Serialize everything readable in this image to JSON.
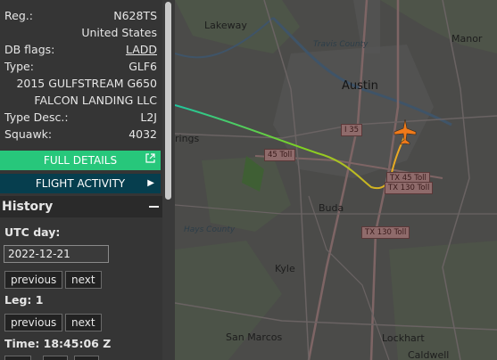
{
  "info": {
    "reg_label": "Reg.:",
    "reg_value": "N628TS",
    "country": "United States",
    "dbflags_label": "DB flags:",
    "dbflags_value": "LADD",
    "type_label": "Type:",
    "type_value": "GLF6",
    "model": "2015 GULFSTREAM G650",
    "owner": "FALCON LANDING LLC",
    "typedesc_label": "Type Desc.:",
    "typedesc_value": "L2J",
    "squawk_label": "Squawk:",
    "squawk_value": "4032"
  },
  "buttons": {
    "full_details": "FULL DETAILS",
    "flight_activity": "FLIGHT ACTIVITY"
  },
  "history": {
    "title": "History",
    "utc_day_label": "UTC day:",
    "utc_day_value": "2022-12-21",
    "previous": "previous",
    "next": "next",
    "leg_label": "Leg: 1",
    "time_label": "Time: 18:45:06 Z"
  },
  "map": {
    "places": {
      "lakeway": "Lakeway",
      "manor": "Manor",
      "austin": "Austin",
      "springs": "rings",
      "buda": "Buda",
      "kyle": "Kyle",
      "san_marcos": "San Marcos",
      "lockhart": "Lockhart",
      "caldwell": "Caldwell"
    },
    "water": {
      "travis_county": "Travis County",
      "hays_county": "Hays County"
    },
    "roads": {
      "i35": "I 35",
      "toll45": "45 Toll",
      "tx45": "TX 45 Toll",
      "tx130a": "TX 130 Toll",
      "tx130b": "TX 130 Toll"
    },
    "colors": {
      "aircraft": "#f07a1a",
      "track_start": "#1fc6a0",
      "track_mid": "#7ed321",
      "track_end": "#f5a623"
    }
  }
}
